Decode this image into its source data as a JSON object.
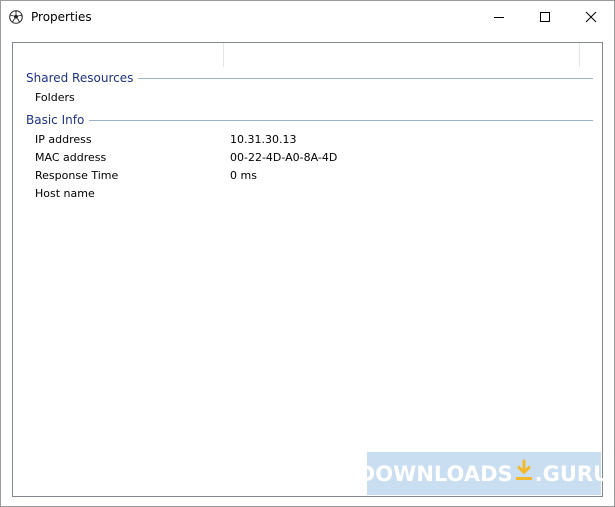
{
  "window": {
    "title": "Properties",
    "app_icon": "soccer-ball-icon",
    "caption_buttons": [
      "minimize-icon",
      "maximize-icon",
      "close-icon"
    ]
  },
  "groups": [
    {
      "title": "Shared Resources",
      "rows": [
        {
          "label": "Folders",
          "value": ""
        }
      ]
    },
    {
      "title": "Basic Info",
      "rows": [
        {
          "label": "IP address",
          "value": "10.31.30.13"
        },
        {
          "label": "MAC address",
          "value": "00-22-4D-A0-8A-4D"
        },
        {
          "label": "Response Time",
          "value": "0 ms"
        },
        {
          "label": "Host name",
          "value": ""
        }
      ]
    }
  ],
  "watermark": {
    "left": "DOWNLOADS",
    "right": ".GURU",
    "icon": "download-arrow-icon"
  },
  "colors": {
    "group_title": "#1e3287",
    "group_line": "#99b3c9",
    "watermark_bg": "#c9def0"
  }
}
